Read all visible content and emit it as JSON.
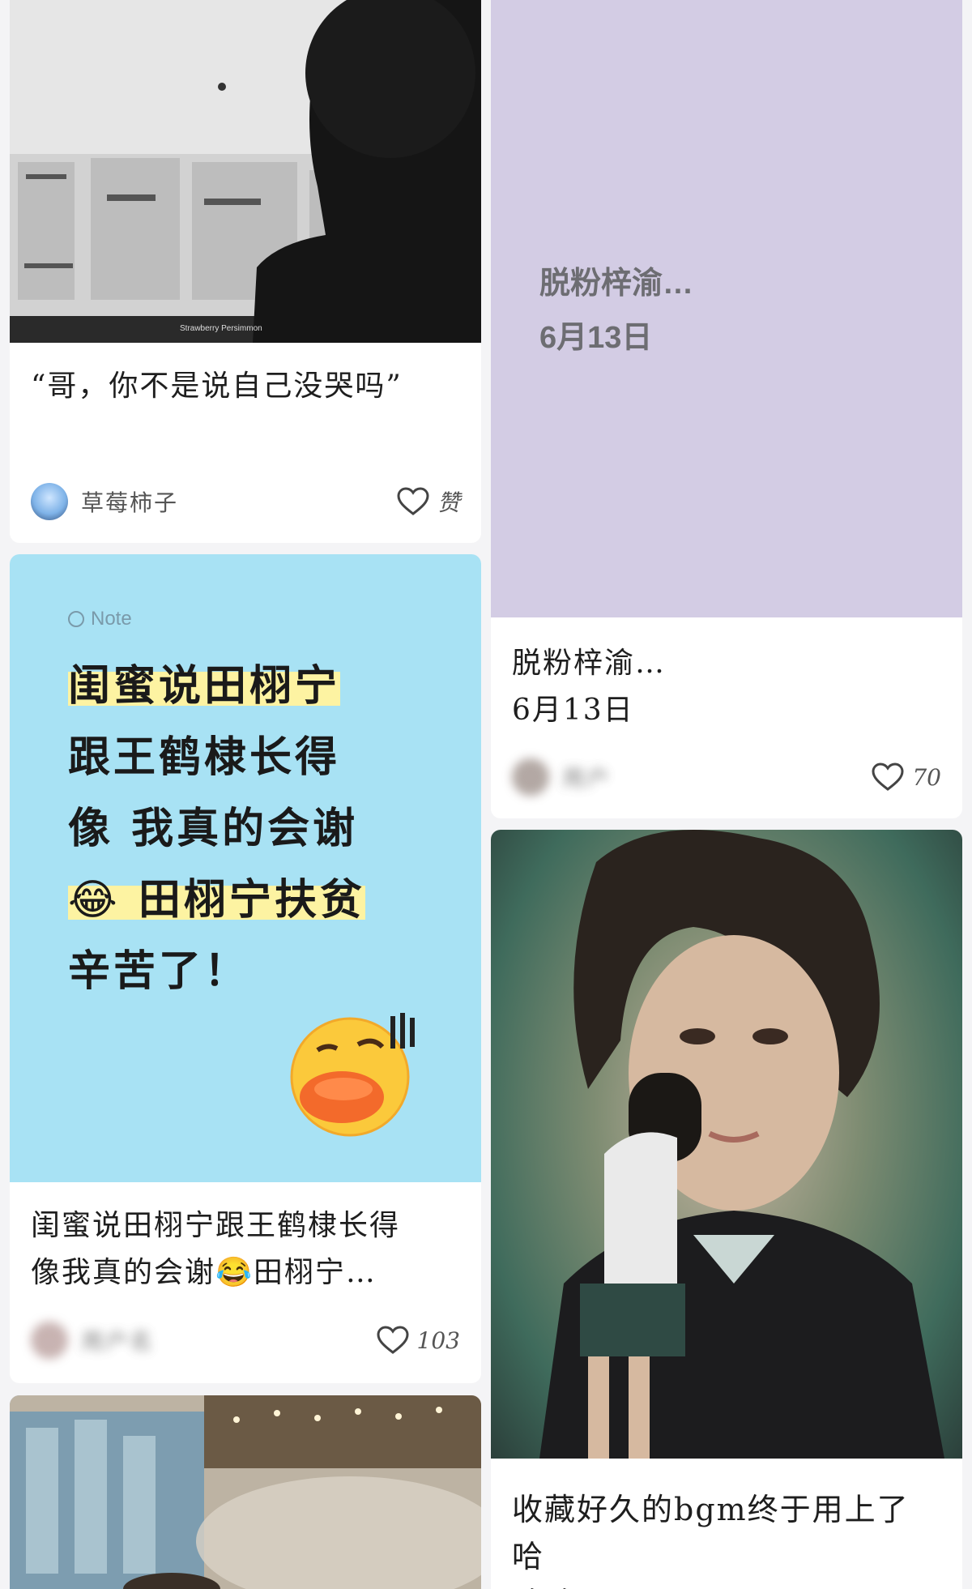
{
  "feed": {
    "cards": [
      {
        "title": "“哥，你不是说自己没哭吗”",
        "image_caption": "Strawberry Persimmon",
        "author": "草莓柿子",
        "likes": "赞"
      },
      {
        "image_text_line1": "脱粉梓渝…",
        "image_text_line2": "6月13日",
        "title_line1": "脱粉梓渝…",
        "title_line2": "6月13日",
        "author": "用户",
        "likes": "70"
      },
      {
        "note_tag": "Note",
        "image_lines": [
          "闺蜜说田栩宁",
          "跟王鹤棣长得",
          "像 我真的会谢",
          "😂 田栩宁扶贫",
          "辛苦了！"
        ],
        "title_line1": "闺蜜说田栩宁跟王鹤棣长得",
        "title_line2": "像我真的会谢😂田栩宁…",
        "author": "用户名",
        "likes": "103"
      },
      {
        "title_line1": "收藏好久的bgm终于用上了哈",
        "title_line2": "哈哈"
      },
      {
        "image_desc": "concert"
      }
    ]
  },
  "colors": {
    "lavender": "#d3cce4",
    "sky": "#a8e2f4",
    "highlight": "#fdf3a2"
  }
}
